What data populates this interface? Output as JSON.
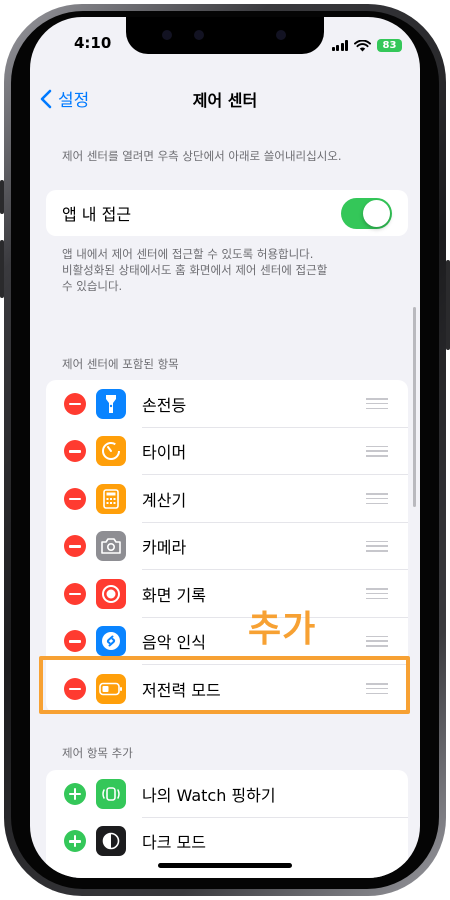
{
  "status": {
    "time": "4:10",
    "battery": "83"
  },
  "nav": {
    "back_label": "설정",
    "title": "제어 센터"
  },
  "intro_caption": "제어 센터를 열려면 우측 상단에서 아래로 쓸어내리십시오.",
  "in_app_access": {
    "label": "앱 내 접근",
    "enabled": true,
    "footer_line1": "앱 내에서 제어 센터에 접근할 수 있도록 허용합니다.",
    "footer_line2": "비활성화된 상태에서도 홈 화면에서 제어 센터에 접근할",
    "footer_line3": "수 있습니다."
  },
  "included": {
    "header": "제어 센터에 포함된 항목",
    "items": [
      {
        "label": "손전등",
        "icon": "flashlight-icon",
        "color": "#0a84ff"
      },
      {
        "label": "타이머",
        "icon": "timer-icon",
        "color": "#ff9f0a"
      },
      {
        "label": "계산기",
        "icon": "calculator-icon",
        "color": "#ff9f0a"
      },
      {
        "label": "카메라",
        "icon": "camera-icon",
        "color": "#8e8e93"
      },
      {
        "label": "화면 기록",
        "icon": "screen-record-icon",
        "color": "#ff3b30"
      },
      {
        "label": "음악 인식",
        "icon": "shazam-icon",
        "color": "#0a84ff"
      },
      {
        "label": "저전력 모드",
        "icon": "low-power-battery-icon",
        "color": "#ff9f0a"
      }
    ]
  },
  "more": {
    "header": "제어 항목 추가",
    "items": [
      {
        "label": "나의 Watch 핑하기",
        "icon": "watch-ping-icon",
        "color": "#34c759"
      },
      {
        "label": "다크 모드",
        "icon": "dark-mode-icon",
        "color": "#1c1c1e"
      }
    ]
  },
  "annotation": {
    "text": "추가",
    "color": "#f7a133"
  },
  "colors": {
    "accent": "#007aff",
    "switch_on": "#34c759",
    "delete": "#ff3b30"
  }
}
